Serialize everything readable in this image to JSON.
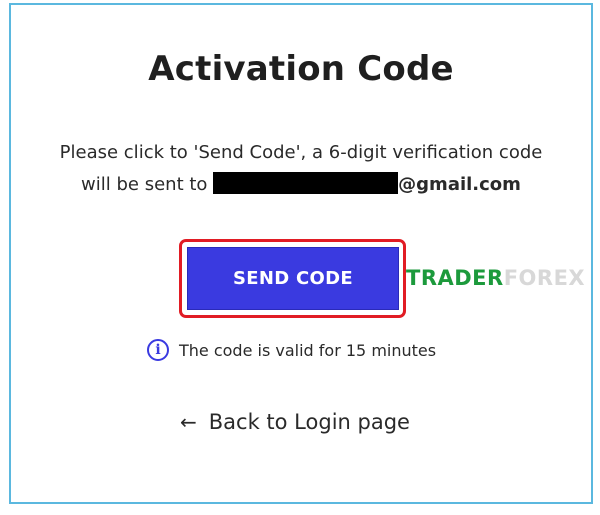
{
  "page": {
    "title": "Activation Code",
    "description_line1": "Please click to 'Send Code', a 6-digit verification code",
    "description_line2_prefix": "will be sent to",
    "email_suffix": "@gmail.com"
  },
  "send_button": {
    "label": "SEND CODE"
  },
  "info": {
    "icon": "info-icon",
    "text": "The code is valid for 15 minutes"
  },
  "back_link": {
    "icon": "arrow-left-icon",
    "label": "Back to Login page"
  },
  "watermark": {
    "part1": "TRADER",
    "part2": "FOREX"
  },
  "colors": {
    "button": "#3a3ae0",
    "highlight": "#e11c24",
    "frame": "#5bb8df",
    "info": "#3a3ae0"
  }
}
